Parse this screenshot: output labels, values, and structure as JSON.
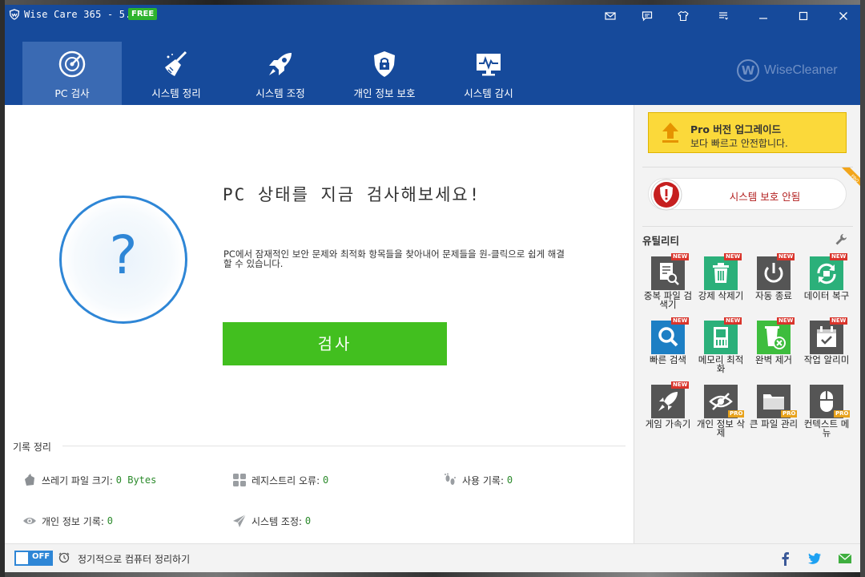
{
  "app": {
    "title": "Wise Care 365 - 5.6.6",
    "badge": "FREE"
  },
  "nav": [
    {
      "label": "PC 검사",
      "icon": "pc-check-icon"
    },
    {
      "label": "시스템 정리",
      "icon": "broom-icon"
    },
    {
      "label": "시스템 조정",
      "icon": "rocket-icon"
    },
    {
      "label": "개인 정보 보호",
      "icon": "lock-shield-icon"
    },
    {
      "label": "시스템 감시",
      "icon": "monitor-icon"
    }
  ],
  "brand": {
    "mark": "W",
    "name": "WiseCleaner"
  },
  "main": {
    "headline": "PC 상태를 지금 검사해보세요!",
    "description": "PC에서 잠재적인 보안 문제와 최적화 항목들을 찾아내어 문제들을 원-클릭으로 쉽게 해결할 수 있습니다.",
    "scan_label": "검사",
    "question": "?"
  },
  "records": {
    "title": "기록 정리",
    "items": [
      {
        "label": "쓰레기 파일 크기:",
        "value": "0 Bytes",
        "icon": "trash-bag-icon"
      },
      {
        "label": "레지스트리 오류:",
        "value": "0",
        "icon": "registry-icon"
      },
      {
        "label": "사용 기록:",
        "value": "0",
        "icon": "footprint-icon"
      },
      {
        "label": "개인 정보 기록:",
        "value": "0",
        "icon": "eye-icon"
      },
      {
        "label": "시스템 조정:",
        "value": "0",
        "icon": "paper-plane-icon"
      }
    ]
  },
  "right": {
    "pro_line1": "Pro 버전 업그레이드",
    "pro_line2": "보다 빠르고 안전합니다.",
    "protect_status": "시스템 보호 안됨",
    "ribbon": "PRO",
    "utilities_title": "유틸리티",
    "tiles": [
      {
        "label": "중복 파일 검색기",
        "badge": "NEW",
        "color": "#555555",
        "icon": "duplicate-search-icon"
      },
      {
        "label": "강제 삭제기",
        "badge": "NEW",
        "color": "#2bb07a",
        "icon": "delete-icon"
      },
      {
        "label": "자동 종료",
        "badge": "NEW",
        "color": "#555555",
        "icon": "power-icon"
      },
      {
        "label": "데이터 복구",
        "badge": "NEW",
        "color": "#2bb07a",
        "icon": "recovery-icon"
      },
      {
        "label": "빠른 검색",
        "badge": "NEW",
        "color": "#1d7fc4",
        "icon": "search-icon"
      },
      {
        "label": "메모리 최적화",
        "badge": "NEW",
        "color": "#2bb07a",
        "icon": "memory-icon"
      },
      {
        "label": "완벽 제거",
        "badge": "NEW",
        "color": "#3ebd3e",
        "icon": "uninstall-icon"
      },
      {
        "label": "작업 알리미",
        "badge": "NEW",
        "color": "#555555",
        "icon": "calendar-icon"
      },
      {
        "label": "게임 가속기",
        "badge": "NEW",
        "color": "#555555",
        "icon": "rocket-icon"
      },
      {
        "label": "개인 정보 삭제",
        "badge": "PRO",
        "color": "#555555",
        "icon": "hidden-eye-icon"
      },
      {
        "label": "큰 파일 관리",
        "badge": "PRO",
        "color": "#555555",
        "icon": "folder-icon"
      },
      {
        "label": "컨텍스트 메뉴",
        "badge": "PRO",
        "color": "#555555",
        "icon": "mouse-icon"
      }
    ]
  },
  "status": {
    "toggle": "OFF",
    "text": "정기적으로 컴퓨터 정리하기"
  }
}
